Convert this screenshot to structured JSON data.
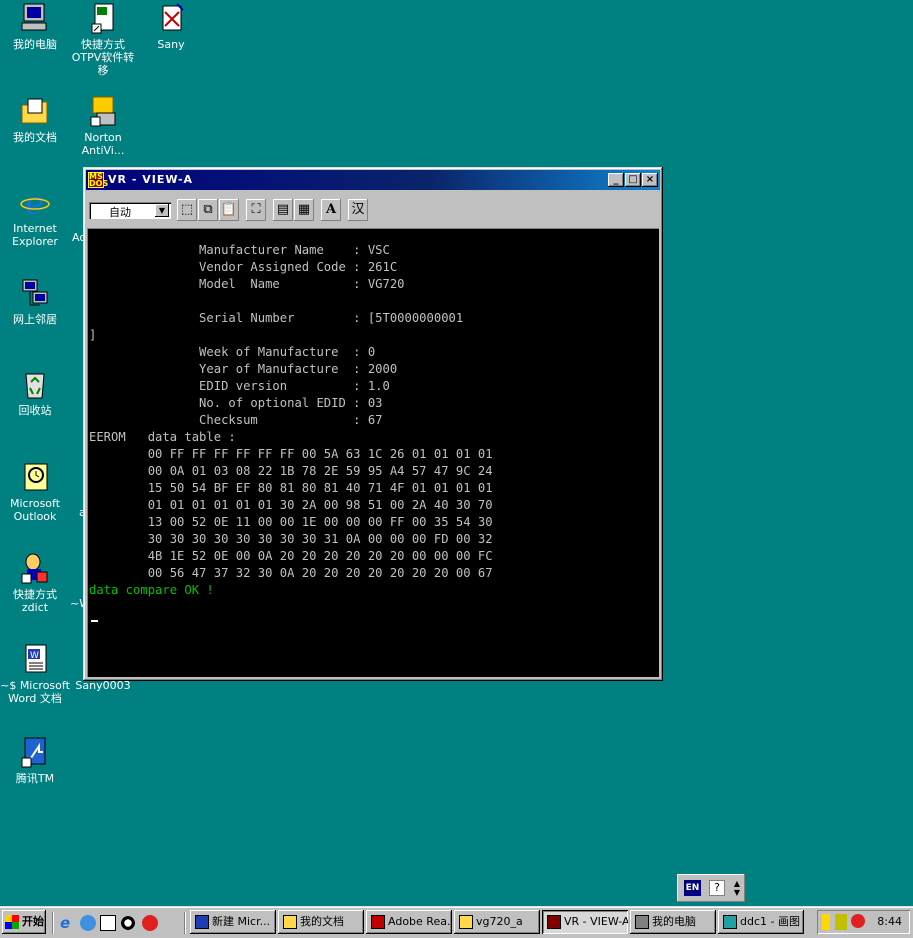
{
  "desktop": {
    "icons": [
      {
        "label": "我的电脑",
        "icon": "my-computer-icon"
      },
      {
        "label": "快捷方式\nOTPV软件转移",
        "icon": "excel-shortcut-icon"
      },
      {
        "label": "Sany",
        "icon": "text-file-icon"
      },
      {
        "label": "我的文档",
        "icon": "my-documents-icon"
      },
      {
        "label": "Norton\nAntiVi...",
        "icon": "norton-icon"
      },
      {
        "label": "Internet\nExplorer",
        "icon": "ie-icon"
      },
      {
        "label": "网上邻居",
        "icon": "network-icon"
      },
      {
        "label": "回收站",
        "icon": "recycle-bin-icon"
      },
      {
        "label": "Microsoft\nOutlook",
        "icon": "outlook-icon"
      },
      {
        "label": "快捷方式\nzdict",
        "icon": "zdict-icon"
      },
      {
        "label": "~$ Microsoft\nWord 文档",
        "icon": "word-doc-icon"
      },
      {
        "label": "Sany0003",
        "icon": "sany0003-icon"
      },
      {
        "label": "腾讯TM",
        "icon": "tencent-tm-icon"
      }
    ],
    "partial_labels": [
      "Ad",
      "a",
      "~W"
    ]
  },
  "window": {
    "title": "VR - VIEW-A",
    "toolbar": {
      "font_select": "自动",
      "buttons": [
        "mark-icon",
        "copy-icon",
        "paste-icon",
        "fullscreen-icon",
        "properties-icon",
        "background-icon",
        "font-icon",
        "ime-icon"
      ],
      "font_glyph": "A",
      "ime_glyph": "汉"
    },
    "console_lines": [
      "               Manufacturer Name    : VSC",
      "               Vendor Assigned Code : 261C",
      "               Model  Name          : VG720",
      "",
      "               Serial Number        : [5T0000000001",
      "]",
      "               Week of Manufacture  : 0",
      "               Year of Manufacture  : 2000",
      "               EDID version         : 1.0",
      "               No. of optional EDID : 03",
      "               Checksum             : 67",
      "EEROM   data table :",
      "        00 FF FF FF FF FF FF 00 5A 63 1C 26 01 01 01 01",
      "        00 0A 01 03 08 22 1B 78 2E 59 95 A4 57 47 9C 24",
      "        15 50 54 BF EF 80 81 80 81 40 71 4F 01 01 01 01",
      "        01 01 01 01 01 01 30 2A 00 98 51 00 2A 40 30 70",
      "        13 00 52 0E 11 00 00 1E 00 00 00 FF 00 35 54 30",
      "        30 30 30 30 30 30 30 30 31 0A 00 00 00 FD 00 32",
      "        4B 1E 52 0E 00 0A 20 20 20 20 20 20 00 00 00 FC",
      "        00 56 47 37 32 30 0A 20 20 20 20 20 20 20 00 67"
    ],
    "status_line": "data compare OK !"
  },
  "langbar": {
    "lang": "EN",
    "help": "?"
  },
  "taskbar": {
    "start_label": "开始",
    "tasks": [
      {
        "label": "新建 Micr...",
        "icon": "word-icon",
        "active": false
      },
      {
        "label": "我的文档",
        "icon": "folder-icon",
        "active": false
      },
      {
        "label": "Adobe Rea...",
        "icon": "acrobat-icon",
        "active": false
      },
      {
        "label": "vg720_a",
        "icon": "folder-icon",
        "active": false
      },
      {
        "label": "VR - VIEW-A",
        "icon": "msdos-icon",
        "active": true
      },
      {
        "label": "我的电脑",
        "icon": "computer-icon",
        "active": false
      },
      {
        "label": "ddc1 - 画图",
        "icon": "paint-icon",
        "active": false
      }
    ],
    "clock": "8:44"
  }
}
